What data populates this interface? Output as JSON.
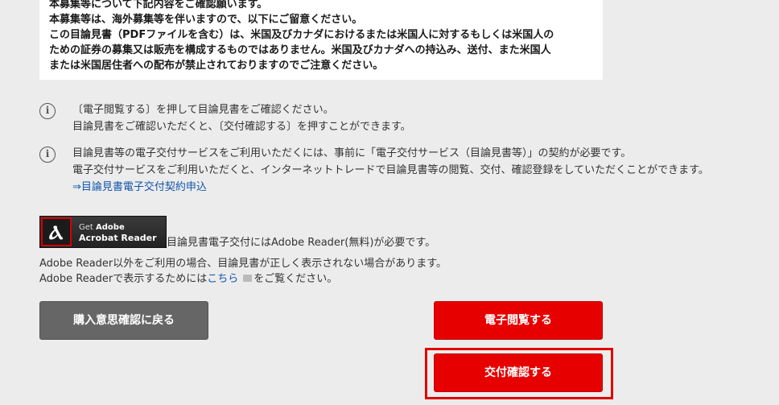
{
  "notice": {
    "lines": [
      "本募集等について下記内容をご確認願います。",
      "本募集等は、海外募集等を伴いますので、以下にご留意ください。",
      "この目論見書（PDFファイルを含む）は、米国及びカナダにおけるまたは米国人に対するもしくは米国人の",
      "ための証券の募集又は販売を構成するものではありません。米国及びカナダへの持込み、送付、また米国人",
      "または米国居住者への配布が禁止されておりますのでご注意ください。"
    ]
  },
  "info": [
    {
      "icon": "info-icon",
      "lines": [
        "〔電子閲覧する〕を押して目論見書をご確認ください。",
        "目論見書をご確認いただくと、〔交付確認する〕を押すことができます。"
      ]
    },
    {
      "icon": "info-icon",
      "lines": [
        "目論見書等の電子交付サービスをご利用いただくには、事前に「電子交付サービス（目論見書等）」の契約が必要です。",
        "電子交付サービスをご利用いただくと、インターネットトレードで目論見書等の閲覧、交付、確認登録をしていただくことができます。"
      ],
      "link": "⇒目論見書電子交付契約申込"
    }
  ],
  "adobe": {
    "badge_get": "Get",
    "badge_brand": "Adobe",
    "badge_name": "Acrobat Reader",
    "requirement": "目論見書電子交付にはAdobe Reader(無料)が必要です。",
    "note1": "Adobe Reader以外をご利用の場合、目論見書が正しく表示されない場合があります。",
    "note2_pre": "Adobe Readerで表示するためには",
    "note2_link": "こちら",
    "note2_post": "をご覧ください。"
  },
  "buttons": {
    "back": "購入意思確認に戻る",
    "view": "電子閲覧する",
    "confirm": "交付確認する"
  },
  "colors": {
    "primary": "#e60000",
    "secondary": "#666666",
    "link": "#1155aa",
    "highlight": "#e00000"
  }
}
